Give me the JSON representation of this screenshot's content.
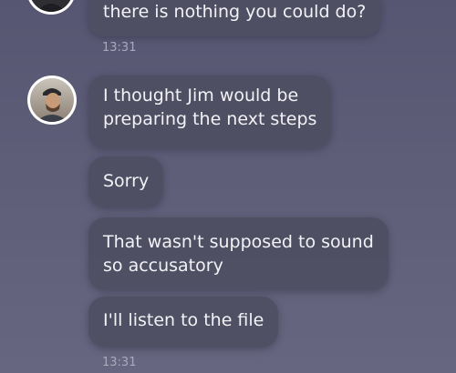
{
  "messages": [
    {
      "text": "there is nothing you could do?"
    },
    {
      "text_line1": "I thought Jim would be",
      "text_line2": "preparing the next steps"
    },
    {
      "text": "Sorry"
    },
    {
      "text_line1": "That wasn't supposed to sound",
      "text_line2": "so accusatory"
    },
    {
      "text": "I'll listen to the file"
    }
  ],
  "timestamps": [
    "13:31",
    "13:31"
  ],
  "colors": {
    "background": "#5d5d78",
    "bubble": "#4e4e62",
    "text": "#f2f2f6",
    "timestamp": "#a9a9bd"
  }
}
